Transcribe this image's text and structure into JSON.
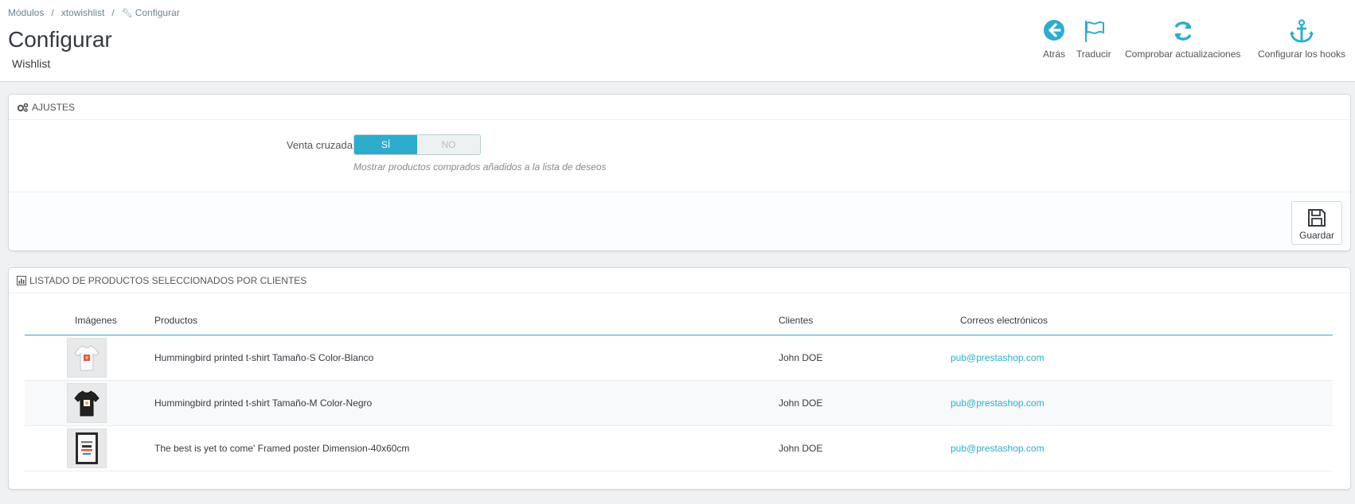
{
  "breadcrumb": {
    "items": [
      "Módulos",
      "xtowishlist",
      "Configurar"
    ]
  },
  "header": {
    "title": "Configurar",
    "subtitle": "Wishlist"
  },
  "toolbar": {
    "back": "Atrás",
    "translate": "Traducir",
    "check_updates": "Comprobar actualizaciones",
    "hooks": "Configurar los hooks"
  },
  "settings": {
    "heading": "AJUSTES",
    "field_label": "Venta cruzada",
    "switch_yes": "SÍ",
    "switch_no": "NO",
    "switch_value": "SÍ",
    "help": "Mostrar productos comprados añadidos a la lista de deseos",
    "save_label": "Guardar"
  },
  "list": {
    "heading": "LISTADO DE PRODUCTOS SELECCIONADOS POR CLIENTES",
    "columns": [
      "Imágenes",
      "Productos",
      "Clientes",
      "Correos electrónicos"
    ],
    "rows": [
      {
        "image": "white-tshirt-thumbnail",
        "product": "Hummingbird printed t-shirt Tamaño-S Color-Blanco",
        "customer": "John DOE",
        "email": "pub@prestashop.com"
      },
      {
        "image": "black-tshirt-thumbnail",
        "product": "Hummingbird printed t-shirt Tamaño-M Color-Negro",
        "customer": "John DOE",
        "email": "pub@prestashop.com"
      },
      {
        "image": "framed-poster-thumbnail",
        "product": "The best is yet to come' Framed poster Dimension-40x60cm",
        "customer": "John DOE",
        "email": "pub@prestashop.com"
      }
    ]
  },
  "colors": {
    "accent": "#2eacce",
    "background": "#eff1f2",
    "text": "#363a41"
  }
}
